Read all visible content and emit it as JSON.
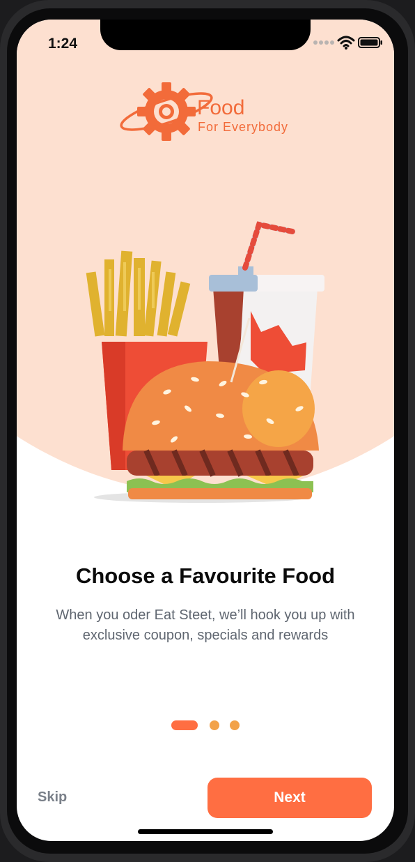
{
  "status_bar": {
    "time": "1:24",
    "icons": [
      "signal-icon",
      "wifi-icon",
      "battery-icon"
    ]
  },
  "logo": {
    "title": "Food",
    "subtitle": "For Everybody",
    "icon": "gear-planet-logo-icon"
  },
  "illustration": {
    "icon": "fast-food-illustration"
  },
  "onboarding": {
    "title": "Choose a Favourite Food",
    "description": "When you oder Eat Steet, we’ll hook you up with exclusive coupon, specials and rewards",
    "page_index": 1,
    "page_count": 3
  },
  "actions": {
    "skip_label": "Skip",
    "next_label": "Next"
  },
  "colors": {
    "accent": "#ff6e42",
    "hero_bg": "#fde0d0",
    "dot_inactive": "#f2a24a",
    "title": "#0b0b0b",
    "body_text": "#5f6670"
  }
}
